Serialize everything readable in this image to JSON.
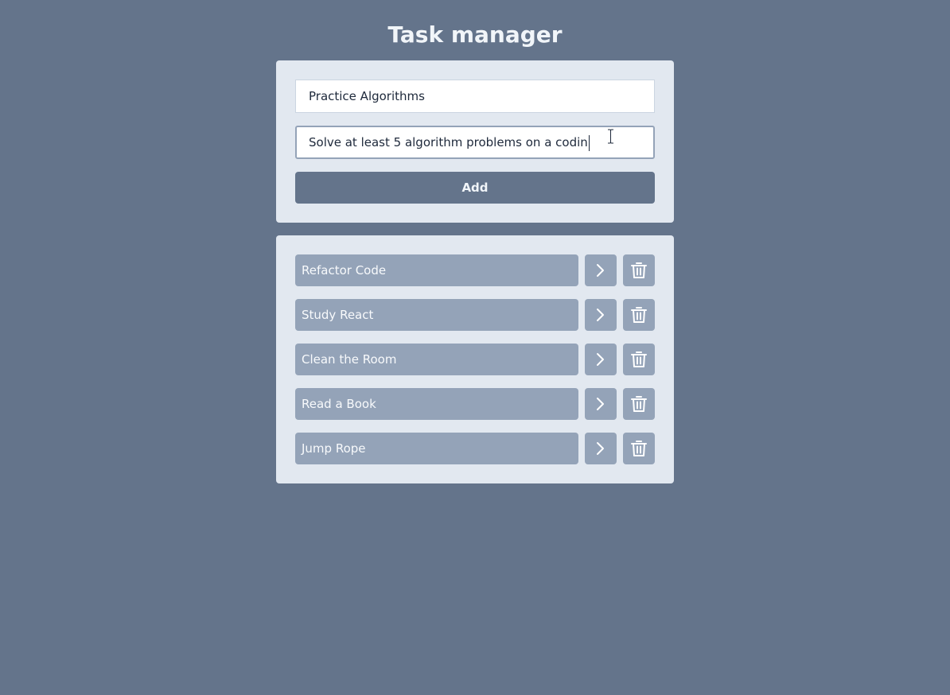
{
  "app": {
    "title": "Task manager"
  },
  "form": {
    "title_value": "Practice Algorithms",
    "description_value": "Solve at least 5 algorithm problems on a codin",
    "add_label": "Add"
  },
  "tasks": [
    {
      "label": "Refactor Code"
    },
    {
      "label": "Study React"
    },
    {
      "label": "Clean the Room"
    },
    {
      "label": "Read a Book"
    },
    {
      "label": "Jump Rope"
    }
  ],
  "icons": {
    "open": "chevron-right-icon",
    "delete": "trash-icon"
  },
  "colors": {
    "background": "#64748b",
    "card": "#e2e8f0",
    "task": "#94a3b8",
    "button": "#64748b",
    "text_light": "#f1f5f9"
  }
}
